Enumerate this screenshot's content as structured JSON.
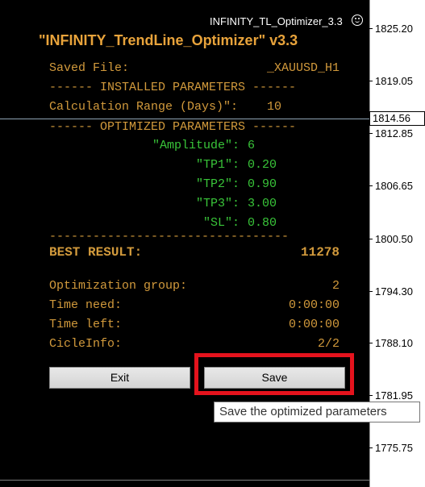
{
  "indicator": {
    "short_name": "INFINITY_TL_Optimizer_3.3",
    "smiley_icon": "smiley-icon"
  },
  "price_axis": {
    "labels": [
      "1825.20",
      "1819.05",
      "1812.85",
      "1806.65",
      "1800.50",
      "1794.30",
      "1788.10",
      "1781.95",
      "1775.75"
    ],
    "current_price": "1814.56"
  },
  "panel": {
    "title": "\"INFINITY_TrendLine_Optimizer\" v3.3",
    "saved_file_label": "Saved File:",
    "saved_file_value": "_XAUUSD_H1",
    "installed_header": "------ INSTALLED PARAMETERS ------",
    "calc_range_label": "Calculation Range (Days)\":",
    "calc_range_value": "10",
    "optimized_header": "------ OPTIMIZED PARAMETERS ------",
    "params": [
      {
        "label": "\"Amplitude\":",
        "value": "6"
      },
      {
        "label": "\"TP1\":",
        "value": "0.20"
      },
      {
        "label": "\"TP2\":",
        "value": "0.90"
      },
      {
        "label": "\"TP3\":",
        "value": "3.00"
      },
      {
        "label": "\"SL\":",
        "value": "0.80"
      }
    ],
    "separator": "---------------------------------",
    "best_result_label": "BEST RESULT:",
    "best_result_value": "11278",
    "opt_group_label": "Optimization group:",
    "opt_group_value": "2",
    "time_need_label": "Time need:",
    "time_need_value": "0:00:00",
    "time_left_label": "Time left:",
    "time_left_value": "0:00:00",
    "cicle_label": "CicleInfo:",
    "cicle_value": "2/2",
    "exit_label": "Exit",
    "save_label": "Save"
  },
  "tooltip": {
    "text": "Save the optimized parameters"
  },
  "colors": {
    "orange": "#d29a3c",
    "green": "#39c439",
    "highlight": "#e5131d",
    "title": "#e8a33b"
  }
}
